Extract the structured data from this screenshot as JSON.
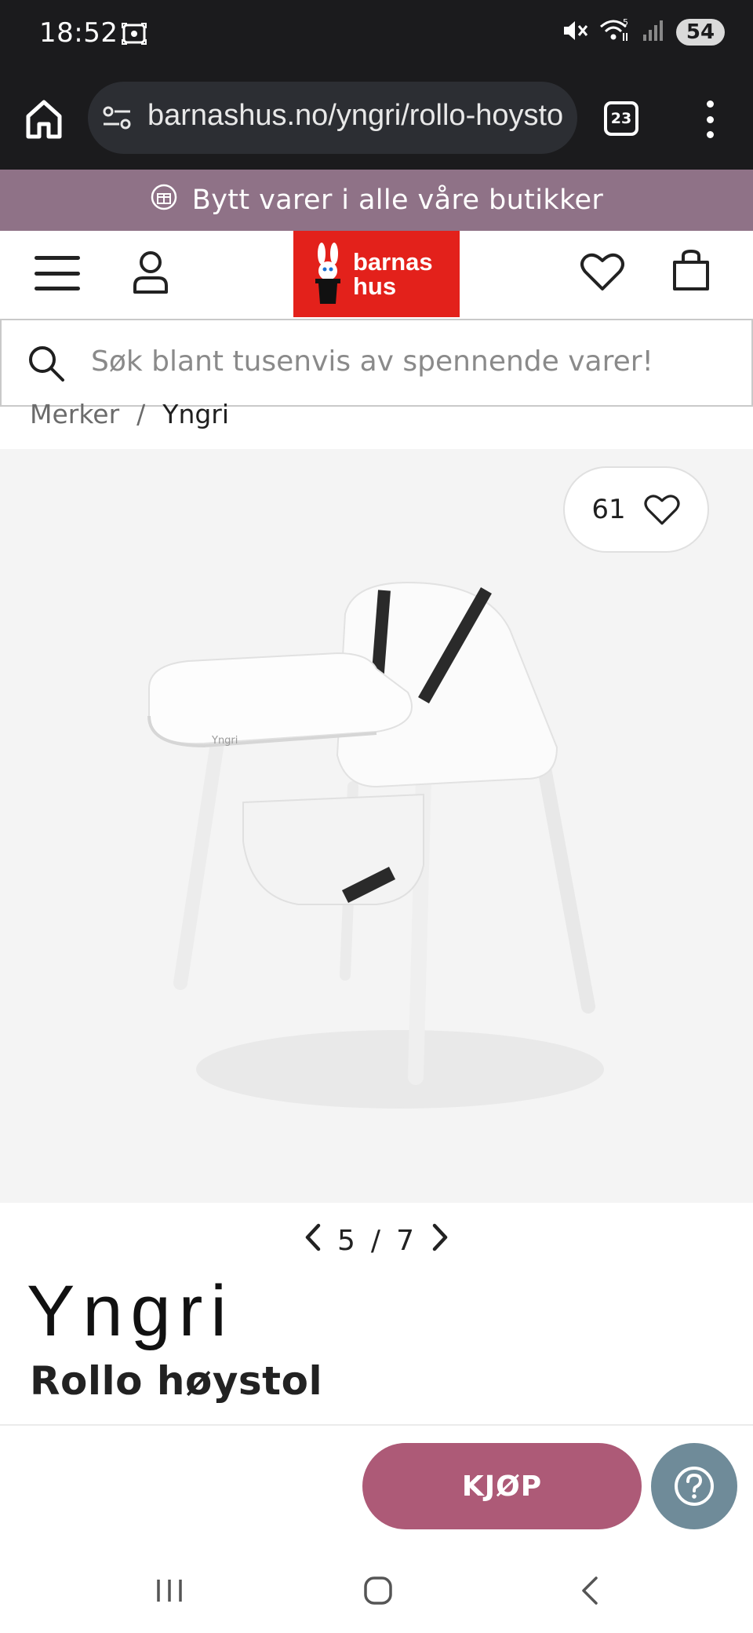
{
  "status_bar": {
    "time": "18:52",
    "battery": "54",
    "wifi_badge": "5"
  },
  "browser": {
    "url": "barnashus.no/yngri/rollo-hoystol",
    "tab_count": "23"
  },
  "promo": {
    "text": "Bytt varer i alle våre butikker"
  },
  "header": {
    "logo_line1": "barnas",
    "logo_line2": "hus"
  },
  "search": {
    "placeholder": "Søk blant tusenvis av spennende varer!"
  },
  "breadcrumb": {
    "items": [
      "Merker",
      "Yngri"
    ],
    "separator": "/"
  },
  "gallery": {
    "favorite_count": "61",
    "current": "5",
    "separator": "/",
    "total": "7"
  },
  "product": {
    "brand": "Yngri",
    "title": "Rollo høystol"
  },
  "actions": {
    "buy_label": "KJØP"
  },
  "colors": {
    "promo_bg": "#8f7287",
    "logo_red": "#e3211b",
    "buy_button": "#ad5a77",
    "help_button": "#6f8b99"
  },
  "icons": [
    "screen-record-icon",
    "mute-icon",
    "wifi-icon",
    "signal-icon",
    "home-icon",
    "tune-icon",
    "tabs-icon",
    "more-icon",
    "gift-icon",
    "menu-icon",
    "account-icon",
    "heart-icon",
    "bag-icon",
    "search-icon",
    "chevron-left-icon",
    "chevron-right-icon",
    "help-icon"
  ]
}
